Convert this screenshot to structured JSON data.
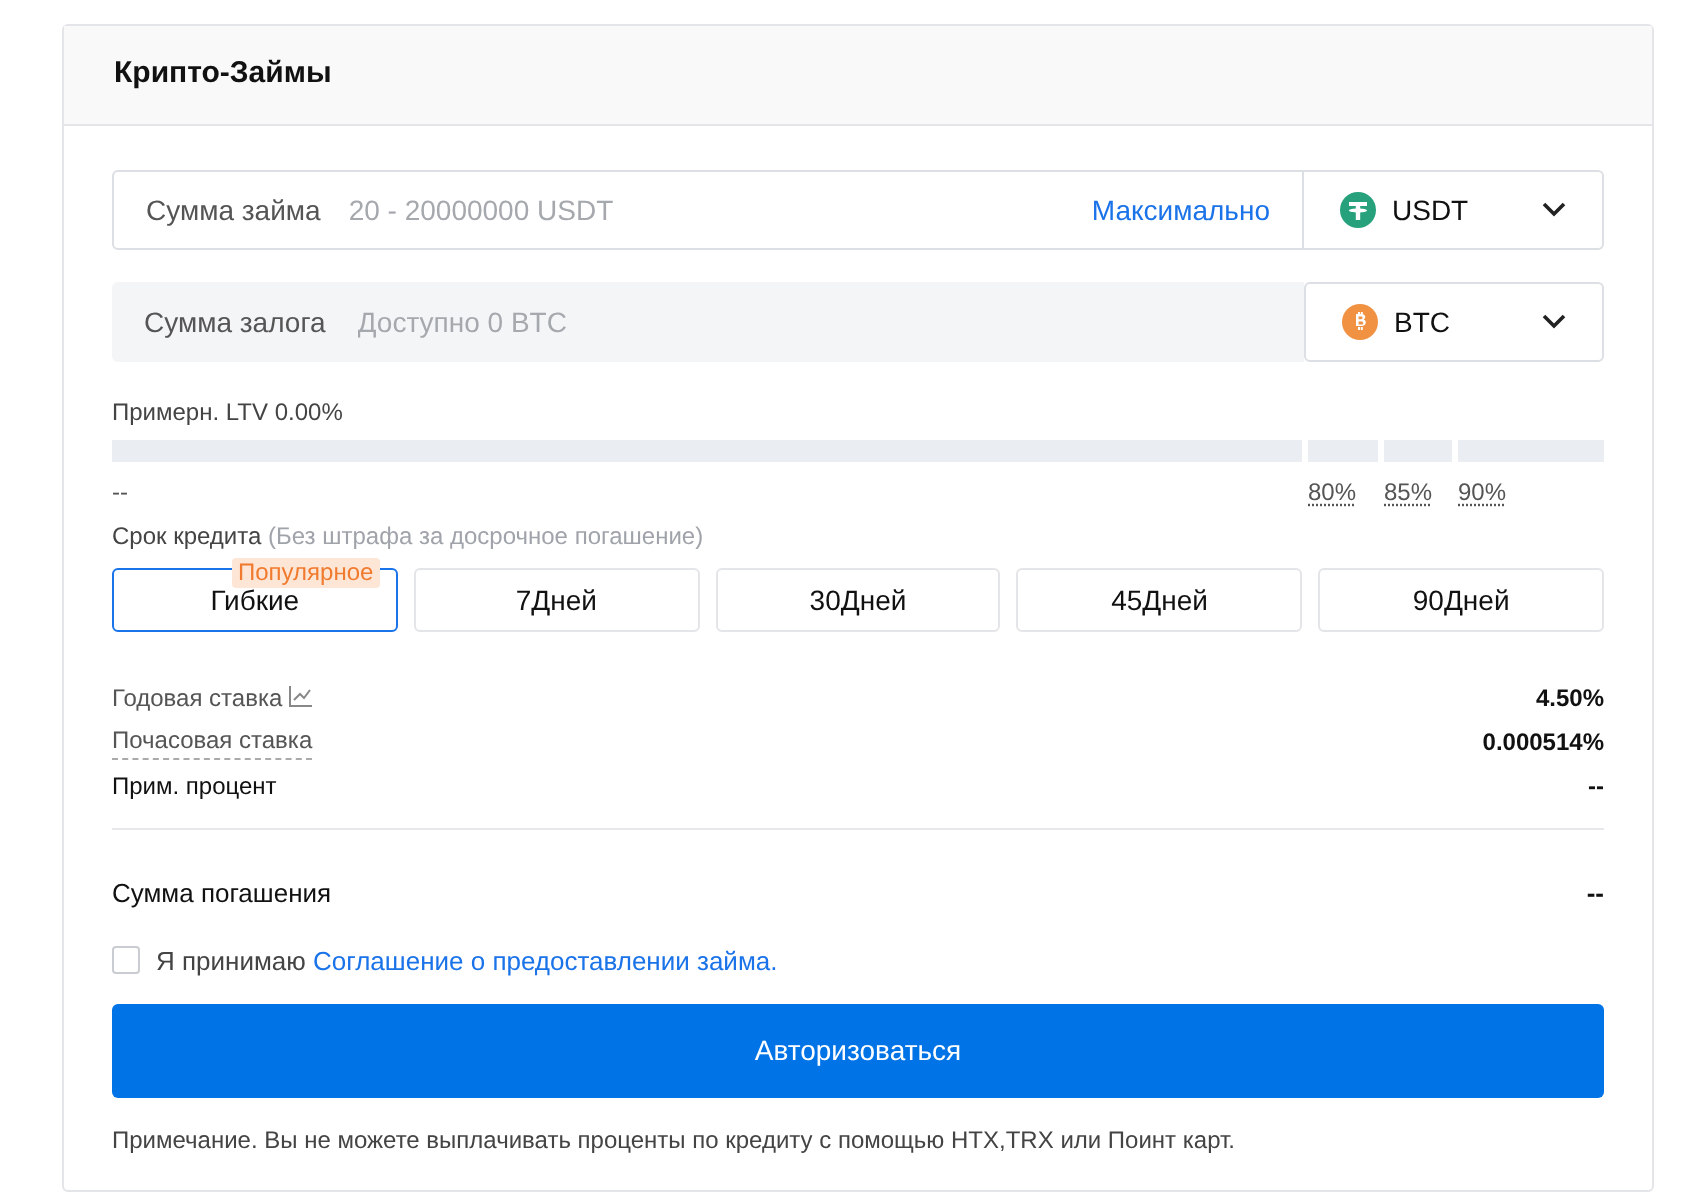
{
  "title": "Крипто-Займы",
  "loan": {
    "label": "Сумма займа",
    "placeholder": "20 - 20000000 USDT",
    "max_link": "Максимально",
    "currency": "USDT",
    "kind": "tether"
  },
  "collateral": {
    "label": "Сумма залога",
    "placeholder": "Доступно 0 BTC",
    "currency": "BTC",
    "kind": "bitcoin"
  },
  "ltv": {
    "label": "Примерн. LTV 0.00%",
    "level": 0,
    "current": "--",
    "marks": [
      "80%",
      "85%",
      "90%"
    ]
  },
  "term": {
    "label": "Срок кредита",
    "hint": "(Без штрафа за досрочное погашение)",
    "options": [
      {
        "label": "Гибкие",
        "selected": true,
        "badge": "Популярное"
      },
      {
        "label": "7Дней",
        "selected": false
      },
      {
        "label": "30Дней",
        "selected": false
      },
      {
        "label": "45Дней",
        "selected": false
      },
      {
        "label": "90Дней",
        "selected": false
      }
    ]
  },
  "rates": [
    {
      "label": "Годовая ставка",
      "value": "4.50%",
      "kind": "chart"
    },
    {
      "label": "Почасовая ставка",
      "value": "0.000514%",
      "kind": "dotted"
    },
    {
      "label": "Прим. процент",
      "value": "--",
      "kind": "plain"
    }
  ],
  "repayment": {
    "label": "Сумма погашения",
    "value": "--"
  },
  "agreement": {
    "checked": false,
    "text": "Я принимаю",
    "link": "Соглашение о предоставлении займа."
  },
  "submit": "Авторизоваться",
  "note": "Примечание. Вы не можете выплачивать проценты по кредиту с помощью HTX,TRX или Поинт карт."
}
